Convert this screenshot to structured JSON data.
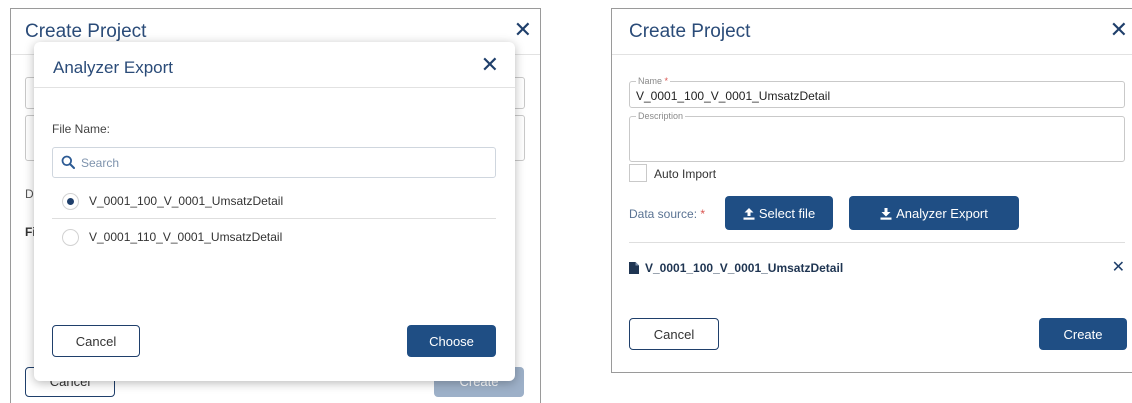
{
  "left_panel": {
    "title": "Create Project",
    "data_source_initial": "D",
    "file_initial": "Fi",
    "cancel_label": "Cancel",
    "create_label": "Create"
  },
  "modal": {
    "title": "Analyzer Export",
    "file_name_label": "File Name:",
    "search_placeholder": "Search",
    "options": [
      {
        "label": "V_0001_100_V_0001_UmsatzDetail",
        "selected": true
      },
      {
        "label": "V_0001_110_V_0001_UmsatzDetail",
        "selected": false
      }
    ],
    "cancel_label": "Cancel",
    "choose_label": "Choose"
  },
  "right_panel": {
    "title": "Create Project",
    "name_label": "Name",
    "name_required": "*",
    "name_value": "V_0001_100_V_0001_UmsatzDetail",
    "description_label": "Description",
    "description_value": "",
    "auto_import_label": "Auto Import",
    "data_source_label": "Data source:",
    "data_source_required": "*",
    "select_file_label": "Select file",
    "analyzer_export_label": "Analyzer Export",
    "selected_file": "V_0001_100_V_0001_UmsatzDetail",
    "cancel_label": "Cancel",
    "create_label": "Create"
  },
  "colors": {
    "primary": "#1f4e84",
    "title": "#2a4b78",
    "required": "#d9534f",
    "disabled": "#9db0c8"
  }
}
